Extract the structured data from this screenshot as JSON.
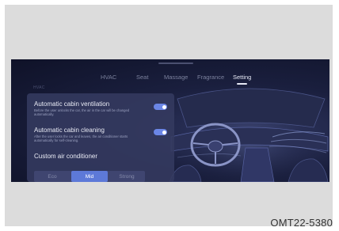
{
  "tabs": [
    {
      "label": "HVAC",
      "active": false
    },
    {
      "label": "Seat",
      "active": false
    },
    {
      "label": "Massage",
      "active": false
    },
    {
      "label": "Fragrance",
      "active": false
    },
    {
      "label": "Setting",
      "active": true
    }
  ],
  "section_hint": "HVAC",
  "settings": {
    "ventilation": {
      "title": "Automatic cabin ventilation",
      "description": "Before the user unlocks the car, the air in the car will be changed automatically.",
      "enabled": true
    },
    "cleaning": {
      "title": "Automatic cabin cleaning",
      "description": "After the user locks the car and leaves, the air conditioner starts automatically for self-cleaning.",
      "enabled": true
    },
    "custom_ac": {
      "title": "Custom air conditioner",
      "options": [
        "Eco",
        "Mid",
        "Strong"
      ],
      "selected": "Mid"
    }
  },
  "colors": {
    "accent": "#5d79d8",
    "panel": "#343a60",
    "screen_bg": "#1a1f3e"
  },
  "figure_code": "OMT22-5380"
}
